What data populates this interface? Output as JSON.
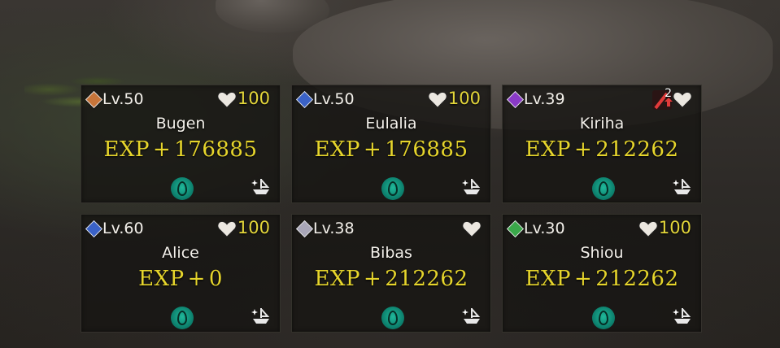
{
  "party": {
    "cards": [
      {
        "level": "Lv.50",
        "name": "Bugen",
        "exp_label": "EXP",
        "plus": "+",
        "exp_value": "176885",
        "affinity": "100",
        "element_color": "#c7753a",
        "element_icon": "fire-element-icon"
      },
      {
        "level": "Lv.50",
        "name": "Eulalia",
        "exp_label": "EXP",
        "plus": "+",
        "exp_value": "176885",
        "affinity": "100",
        "element_color": "#3a62c7",
        "element_icon": "water-element-icon"
      },
      {
        "level": "Lv.39",
        "name": "Kiriha",
        "exp_label": "EXP",
        "plus": "+",
        "exp_value": "212262",
        "affinity": "",
        "element_color": "#8a3ac7",
        "element_icon": "dark-element-icon",
        "buff_count": "2"
      },
      {
        "level": "Lv.60",
        "name": "Alice",
        "exp_label": "EXP",
        "plus": "+",
        "exp_value": "0",
        "affinity": "100",
        "element_color": "#3a62c7",
        "element_icon": "water-element-icon"
      },
      {
        "level": "Lv.38",
        "name": "Bibas",
        "exp_label": "EXP",
        "plus": "+",
        "exp_value": "212262",
        "affinity": "",
        "element_color": "#a8a6b8",
        "element_icon": "light-element-icon"
      },
      {
        "level": "Lv.30",
        "name": "Shiou",
        "exp_label": "EXP",
        "plus": "+",
        "exp_value": "212262",
        "affinity": "100",
        "element_color": "#3aa84a",
        "element_icon": "wind-element-icon"
      }
    ]
  },
  "colors": {
    "exp_yellow": "#e6d52c",
    "gem_teal": "#1fb89a"
  }
}
